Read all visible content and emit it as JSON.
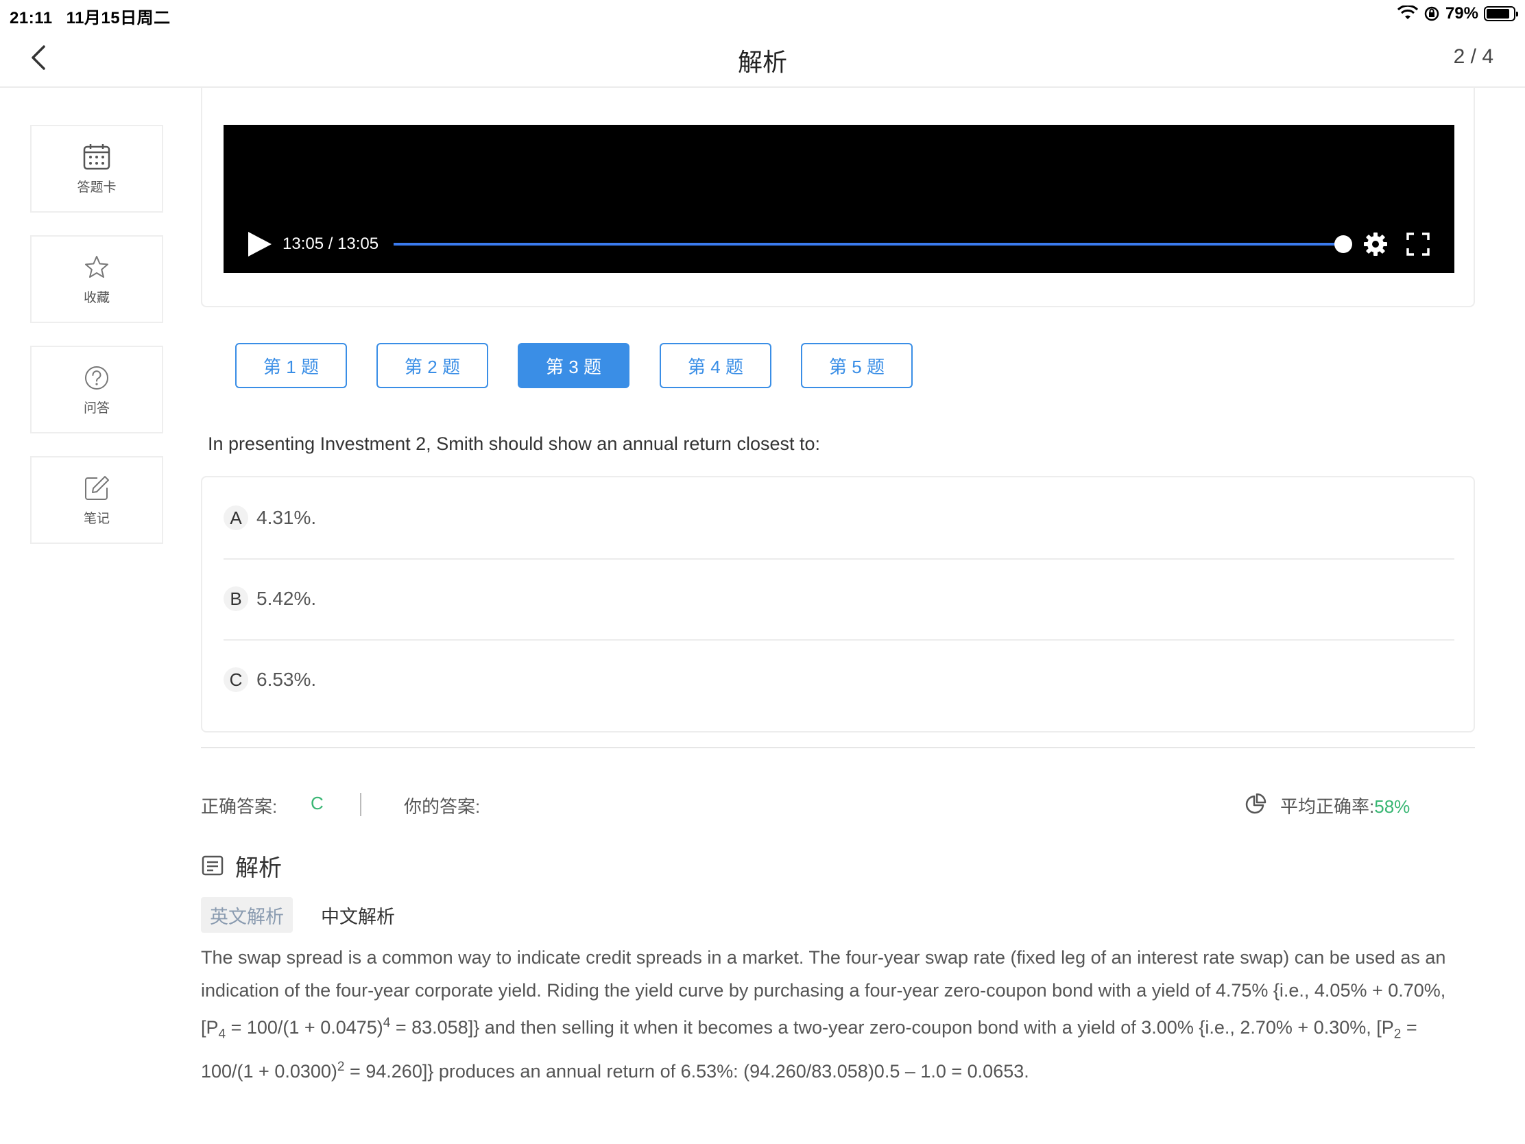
{
  "status": {
    "time": "21:11",
    "date": "11月15日周二",
    "battery": "79%"
  },
  "nav": {
    "title": "解析",
    "page": "2 / 4"
  },
  "sidebar": {
    "items": [
      {
        "label": "答题卡",
        "icon": "calendar-grid-icon"
      },
      {
        "label": "收藏",
        "icon": "star-icon"
      },
      {
        "label": "问答",
        "icon": "question-circle-icon"
      },
      {
        "label": "笔记",
        "icon": "edit-note-icon"
      }
    ]
  },
  "video": {
    "time": "13:05 / 13:05",
    "progress_fraction": 1.0
  },
  "question_tabs": [
    {
      "label": "第 1 题"
    },
    {
      "label": "第 2 题"
    },
    {
      "label": "第 3 题",
      "active": true
    },
    {
      "label": "第 4 题"
    },
    {
      "label": "第 5 题"
    }
  ],
  "question": {
    "text": "In presenting Investment 2, Smith should show an annual return closest to:"
  },
  "options": [
    {
      "letter": "A",
      "text": "4.31%."
    },
    {
      "letter": "B",
      "text": "5.42%."
    },
    {
      "letter": "C",
      "text": "6.53%."
    }
  ],
  "answer": {
    "correct_label": "正确答案:",
    "correct_value": "C",
    "yours_label": "你的答案:",
    "avg_label": "平均正确率:",
    "avg_value": "58%",
    "correct_color": "#38b673"
  },
  "explanation": {
    "title": "解析",
    "tab_en": "英文解析",
    "tab_cn": "中文解析",
    "p1": "The swap spread is a common way to indicate credit spreads in a market. The four-year swap rate (fixed leg of an interest rate swap) can be used as an indication of the four-year corporate yield. Riding the yield curve by purchasing a four-year zero-coupon bond with a yield of 4.75% {i.e., 4.05% + 0.70%, [P",
    "sub1": "4",
    "p2": " = 100/(1 + 0.0475)",
    "sup1": "4",
    "p3": " = 83.058]} and then selling it when it becomes a two-year zero-coupon bond with a yield of 3.00% {i.e., 2.70% + 0.30%, [P",
    "sub2": "2",
    "p4": " = 100/(1 + 0.0300)",
    "sup2": "2",
    "p5": " = 94.260]} produces an annual return of 6.53%: (94.260/83.058)0.5 – 1.0 = 0.0653."
  },
  "colors": {
    "accent": "#3a8ee6",
    "green": "#38b673"
  }
}
